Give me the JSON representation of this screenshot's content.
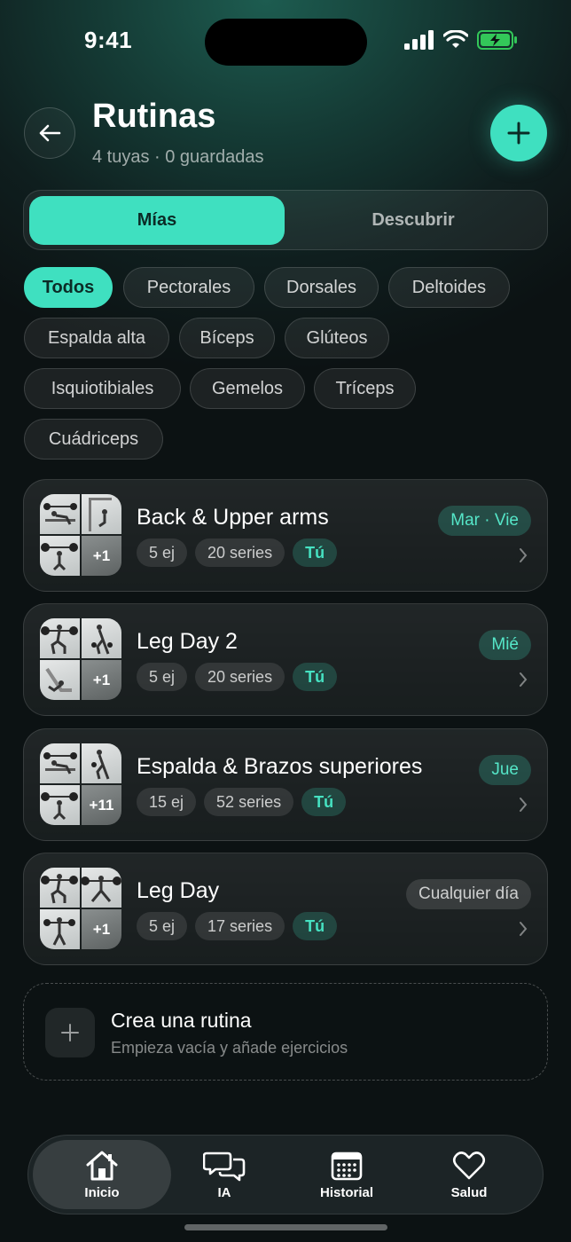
{
  "status_bar": {
    "time": "9:41"
  },
  "header": {
    "title": "Rutinas",
    "subtitle": "4 tuyas · 0 guardadas"
  },
  "segmented": {
    "active": "Mías",
    "inactive": "Descubrir"
  },
  "filters": [
    "Todos",
    "Pectorales",
    "Dorsales",
    "Deltoides",
    "Espalda alta",
    "Bíceps",
    "Glúteos",
    "Isquiotibiales",
    "Gemelos",
    "Tríceps",
    "Cuádriceps"
  ],
  "routines": [
    {
      "name": "Back & Upper arms",
      "exercises": "5 ej",
      "series": "20 series",
      "owner": "Tú",
      "days": "Mar · Vie",
      "more": "+1"
    },
    {
      "name": "Leg Day 2",
      "exercises": "5 ej",
      "series": "20 series",
      "owner": "Tú",
      "days": "Mié",
      "more": "+1"
    },
    {
      "name": "Espalda & Brazos superiores",
      "exercises": "15 ej",
      "series": "52 series",
      "owner": "Tú",
      "days": "Jue",
      "more": "+11"
    },
    {
      "name": "Leg Day",
      "exercises": "5 ej",
      "series": "17 series",
      "owner": "Tú",
      "days": "Cualquier día",
      "more": "+1"
    }
  ],
  "create": {
    "title": "Crea una rutina",
    "subtitle": "Empieza vacía y añade ejercicios"
  },
  "tabbar": {
    "tabs": [
      {
        "label": "Inicio",
        "icon": "home-icon",
        "active": true
      },
      {
        "label": "IA",
        "icon": "chat-icon",
        "active": false
      },
      {
        "label": "Historial",
        "icon": "calendar-icon",
        "active": false
      },
      {
        "label": "Salud",
        "icon": "heart-icon",
        "active": false
      }
    ]
  },
  "colors": {
    "accent": "#3fe0c0",
    "background": "#0c1213"
  }
}
